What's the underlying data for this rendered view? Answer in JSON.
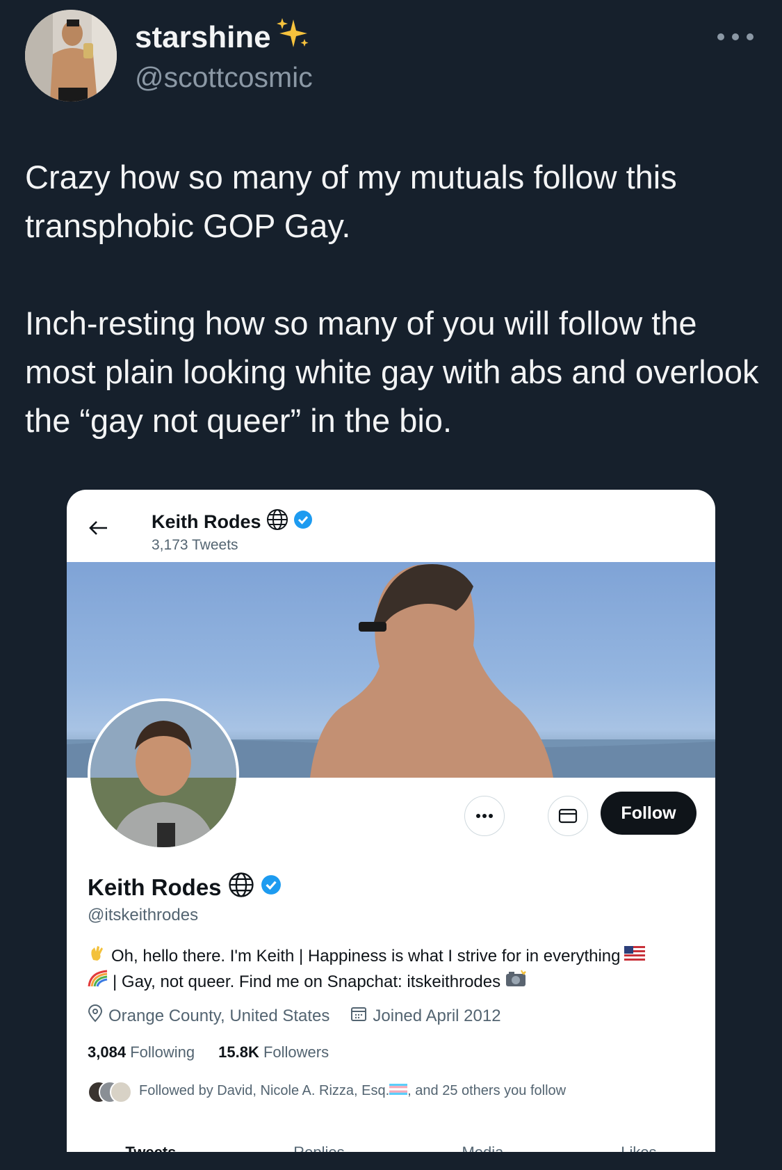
{
  "tweet": {
    "author": {
      "display_name": "starshine",
      "name_emoji": "sparkles-icon",
      "handle": "@scottcosmic"
    },
    "paragraphs": [
      "Crazy how so many of my mutuals follow this transphobic GOP Gay.",
      "Inch-resting how so many of you will follow the most plain looking white gay with abs and overlook the “gay not queer” in the bio."
    ]
  },
  "profile_card": {
    "top_name": "Keith Rodes",
    "tweet_count": "3,173 Tweets",
    "name": "Keith Rodes",
    "handle": "@itskeithrodes",
    "bio_line1": "Oh, hello there. I'm Keith | Happiness is what I strive for in everything",
    "bio_line2": "| Gay, not queer. Find me on Snapchat: itskeithrodes",
    "location": "Orange County, United States",
    "joined": "Joined April 2012",
    "following_count": "3,084",
    "following_label": "Following",
    "followers_count": "15.8K",
    "followers_label": "Followers",
    "followed_by_pre": "Followed by David, Nicole A. Rizza, Esq.",
    "followed_by_post": ", and 25 others you follow",
    "follow_label": "Follow",
    "tabs": [
      "Tweets",
      "Replies",
      "Media",
      "Likes"
    ]
  },
  "colors": {
    "background": "#16202c",
    "verified": "#1d9bf0",
    "card": "#ffffff",
    "follow_button": "#0f1419"
  }
}
